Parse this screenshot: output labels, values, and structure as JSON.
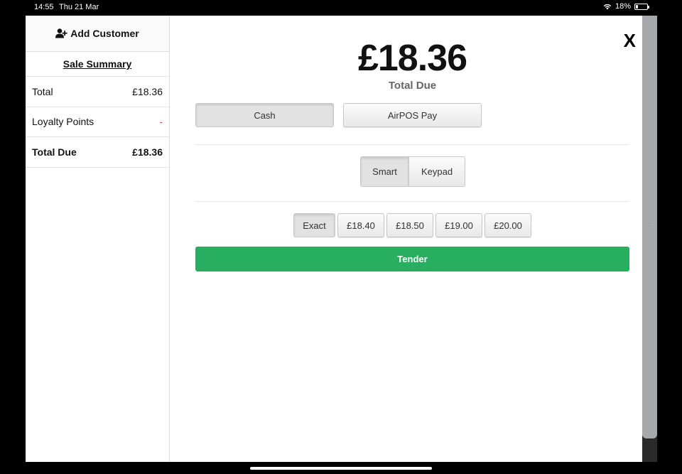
{
  "status_bar": {
    "time": "14:55",
    "date": "Thu 21 Mar",
    "battery": "18%",
    "battery_level": 0.18,
    "wifi_icon": "wifi-icon"
  },
  "sidebar": {
    "add_customer_label": "Add Customer",
    "add_customer_icon": "user-plus-icon",
    "sale_summary_title": "Sale Summary",
    "rows": [
      {
        "label": "Total",
        "value": "£18.36"
      },
      {
        "label": "Loyalty Points",
        "value": "-"
      },
      {
        "label": "Total Due",
        "value": "£18.36"
      }
    ]
  },
  "main": {
    "close_label": "X",
    "total_amount": "£18.36",
    "total_label": "Total Due",
    "payment_methods": [
      "Cash",
      "AirPOS Pay"
    ],
    "selected_payment_method": "Cash",
    "entry_modes": [
      "Smart",
      "Keypad"
    ],
    "selected_entry_mode": "Smart",
    "quick_amounts": [
      "Exact",
      "£18.40",
      "£18.50",
      "£19.00",
      "£20.00"
    ],
    "selected_quick_amount": "Exact",
    "tender_label": "Tender"
  },
  "colors": {
    "tender_green": "#27ae60",
    "loyalty_dash": "#d9534f",
    "frame": "#000000",
    "scrollbar": "#a7a9ac"
  }
}
